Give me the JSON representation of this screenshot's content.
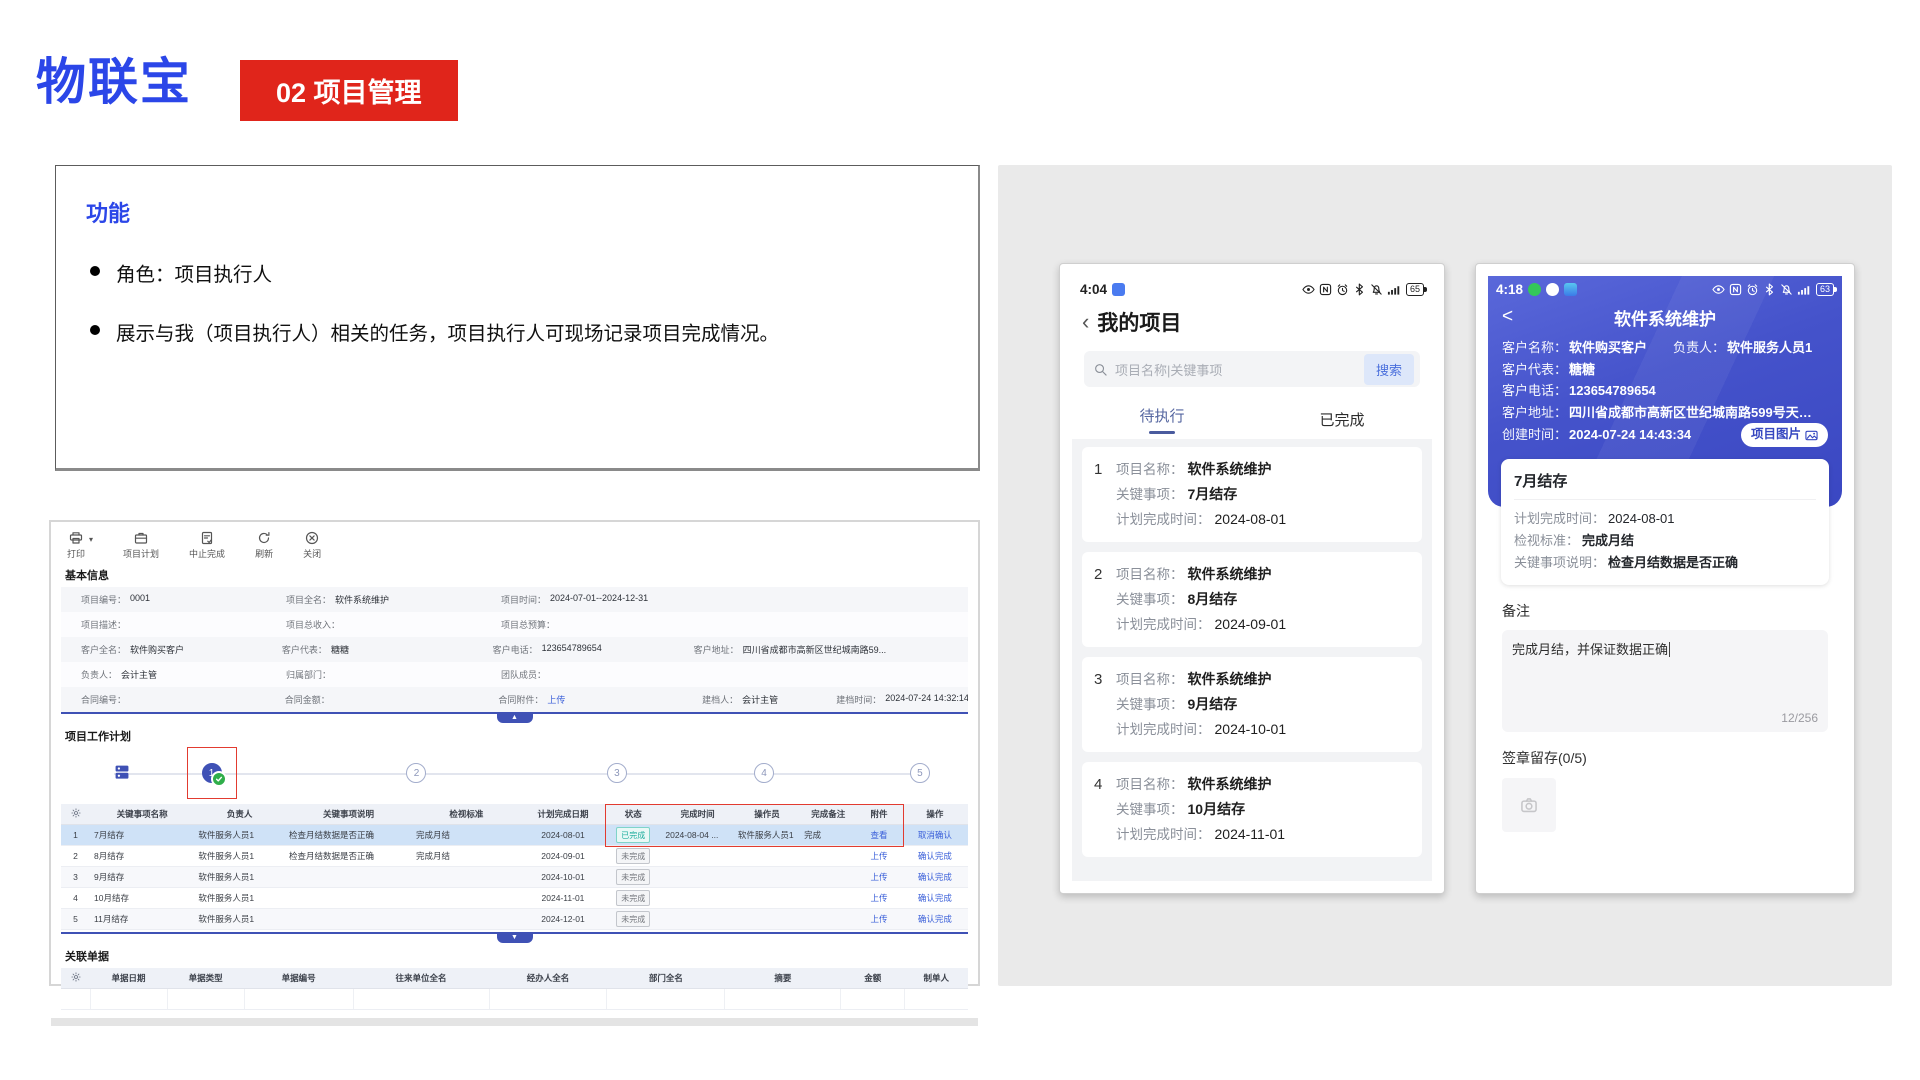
{
  "brand": {
    "logo": "物联宝",
    "badge": "02 项目管理"
  },
  "glyphs": {
    "caret_down": "▾",
    "collapse_up": "▲",
    "collapse_down": "▼"
  },
  "feature_box": {
    "title": "功能",
    "bullets": [
      "角色：项目执行人",
      "展示与我（项目执行人）相关的任务，项目执行人可现场记录项目完成情况。"
    ]
  },
  "desktop": {
    "toolbar": [
      {
        "label": "打印",
        "icon": "printer-icon"
      },
      {
        "label": "项目计划",
        "icon": "briefcase-icon"
      },
      {
        "label": "中止完成",
        "icon": "doc-check-icon"
      },
      {
        "label": "刷新",
        "icon": "refresh-icon"
      },
      {
        "label": "关闭",
        "icon": "close-circle-icon"
      }
    ],
    "basic_info": {
      "title": "基本信息",
      "rows": [
        {
          "cells": [
            {
              "l": "项目编号：",
              "v": "0001"
            },
            {
              "l": "项目全名：",
              "v": "软件系统维护"
            },
            {
              "l": "项目时间：",
              "v": "2024-07-01--2024-12-31"
            }
          ]
        },
        {
          "cells": [
            {
              "l": "项目描述：",
              "v": ""
            },
            {
              "l": "项目总收入：",
              "v": ""
            },
            {
              "l": "项目总预算：",
              "v": ""
            }
          ]
        },
        {
          "cells": [
            {
              "l": "客户全名：",
              "v": "软件购买客户"
            },
            {
              "l": "客户代表：",
              "v": "糖糖"
            },
            {
              "l": "客户电话：",
              "v": "123654789654"
            },
            {
              "l": "客户地址：",
              "v": "四川省成都市高新区世纪城南路59..."
            }
          ]
        },
        {
          "cells": [
            {
              "l": "负责人：",
              "v": "会计主管"
            },
            {
              "l": "归属部门：",
              "v": ""
            },
            {
              "l": "团队成员：",
              "v": ""
            }
          ]
        },
        {
          "cells": [
            {
              "l": "合同编号：",
              "v": ""
            },
            {
              "l": "合同金额：",
              "v": ""
            },
            {
              "l": "合同附件：",
              "v": "上传"
            },
            {
              "l": "建档人：",
              "v": "会计主管"
            },
            {
              "l": "建档时间：",
              "v": "2024-07-24 14:32:14"
            }
          ]
        }
      ]
    },
    "work_plan": {
      "title": "项目工作计划",
      "steps": [
        "1",
        "2",
        "3",
        "4",
        "5"
      ]
    },
    "task_table": {
      "headers": [
        "关键事项名称",
        "负责人",
        "关键事项说明",
        "检视标准",
        "计划完成日期",
        "状态",
        "完成时间",
        "操作员",
        "完成备注",
        "附件",
        "操作"
      ],
      "rows": [
        {
          "num": "1",
          "name": "7月结存",
          "owner": "软件服务人员1",
          "desc": "检查月结数据是否正确",
          "std": "完成月结",
          "plan": "2024-08-01",
          "status": "已完成",
          "time": "2024-08-04 ...",
          "op": "软件服务人员1",
          "note": "完成",
          "attach": "查看",
          "action": "取消确认"
        },
        {
          "num": "2",
          "name": "8月结存",
          "owner": "软件服务人员1",
          "desc": "检查月结数据是否正确",
          "std": "完成月结",
          "plan": "2024-09-01",
          "status": "未完成",
          "time": "",
          "op": "",
          "note": "",
          "attach": "上传",
          "action": "确认完成"
        },
        {
          "num": "3",
          "name": "9月结存",
          "owner": "软件服务人员1",
          "desc": "",
          "std": "",
          "plan": "2024-10-01",
          "status": "未完成",
          "time": "",
          "op": "",
          "note": "",
          "attach": "上传",
          "action": "确认完成"
        },
        {
          "num": "4",
          "name": "10月结存",
          "owner": "软件服务人员1",
          "desc": "",
          "std": "",
          "plan": "2024-11-01",
          "status": "未完成",
          "time": "",
          "op": "",
          "note": "",
          "attach": "上传",
          "action": "确认完成"
        },
        {
          "num": "5",
          "name": "11月结存",
          "owner": "软件服务人员1",
          "desc": "",
          "std": "",
          "plan": "2024-12-01",
          "status": "未完成",
          "time": "",
          "op": "",
          "note": "",
          "attach": "上传",
          "action": "确认完成"
        }
      ]
    },
    "related_docs": {
      "title": "关联单据",
      "headers": [
        "单据日期",
        "单据类型",
        "单据编号",
        "往来单位全名",
        "经办人全名",
        "部门全名",
        "摘要",
        "金额",
        "制单人"
      ]
    }
  },
  "phone1": {
    "status": {
      "time": "4:04",
      "battery": "65"
    },
    "header": {
      "back": "‹",
      "title": "我的项目"
    },
    "search": {
      "placeholder": "项目名称|关键事项",
      "button": "搜索"
    },
    "tabs": {
      "active": "待执行",
      "inactive": "已完成"
    },
    "labels": {
      "name": "项目名称：",
      "key": "关键事项：",
      "plan": "计划完成时间："
    },
    "items": [
      {
        "num": "1",
        "name": "软件系统维护",
        "key": "7月结存",
        "plan": "2024-08-01"
      },
      {
        "num": "2",
        "name": "软件系统维护",
        "key": "8月结存",
        "plan": "2024-09-01"
      },
      {
        "num": "3",
        "name": "软件系统维护",
        "key": "9月结存",
        "plan": "2024-10-01"
      },
      {
        "num": "4",
        "name": "软件系统维护",
        "key": "10月结存",
        "plan": "2024-11-01"
      }
    ]
  },
  "phone2": {
    "status": {
      "time": "4:18",
      "battery": "63"
    },
    "nav": {
      "back": "<",
      "title": "软件系统维护"
    },
    "info_pairs": [
      {
        "l": "客户名称：",
        "v": "软件购买客户"
      },
      {
        "l": "负责人：",
        "v": "软件服务人员1"
      },
      {
        "l": "客户代表：",
        "v": "糖糖"
      },
      {
        "l": "客户电话：",
        "v": "123654789654"
      },
      {
        "l": "客户地址：",
        "v": "四川省成都市高新区世纪城南路599号天…"
      },
      {
        "l": "创建时间：",
        "v": "2024-07-24 14:43:34"
      }
    ],
    "photo_button": "项目图片",
    "card": {
      "title": "7月结存",
      "lines": [
        {
          "l": "计划完成时间：",
          "v": "2024-08-01"
        },
        {
          "l": "检视标准：",
          "v": "完成月结"
        },
        {
          "l": "关键事项说明：",
          "v": "检查月结数据是否正确"
        }
      ]
    },
    "remark": {
      "title": "备注",
      "text": "完成月结，并保证数据正确",
      "counter": "12/256"
    },
    "signature": {
      "title": "签章留存(0/5)"
    }
  },
  "colors": {
    "logo_blue": "#2b46e8",
    "banner_red": "#e0251b",
    "link_blue": "#3a5fd9",
    "phone_blue": "#4553cb",
    "done_teal": "#1fae9e",
    "active_tab": "#5566a0"
  }
}
